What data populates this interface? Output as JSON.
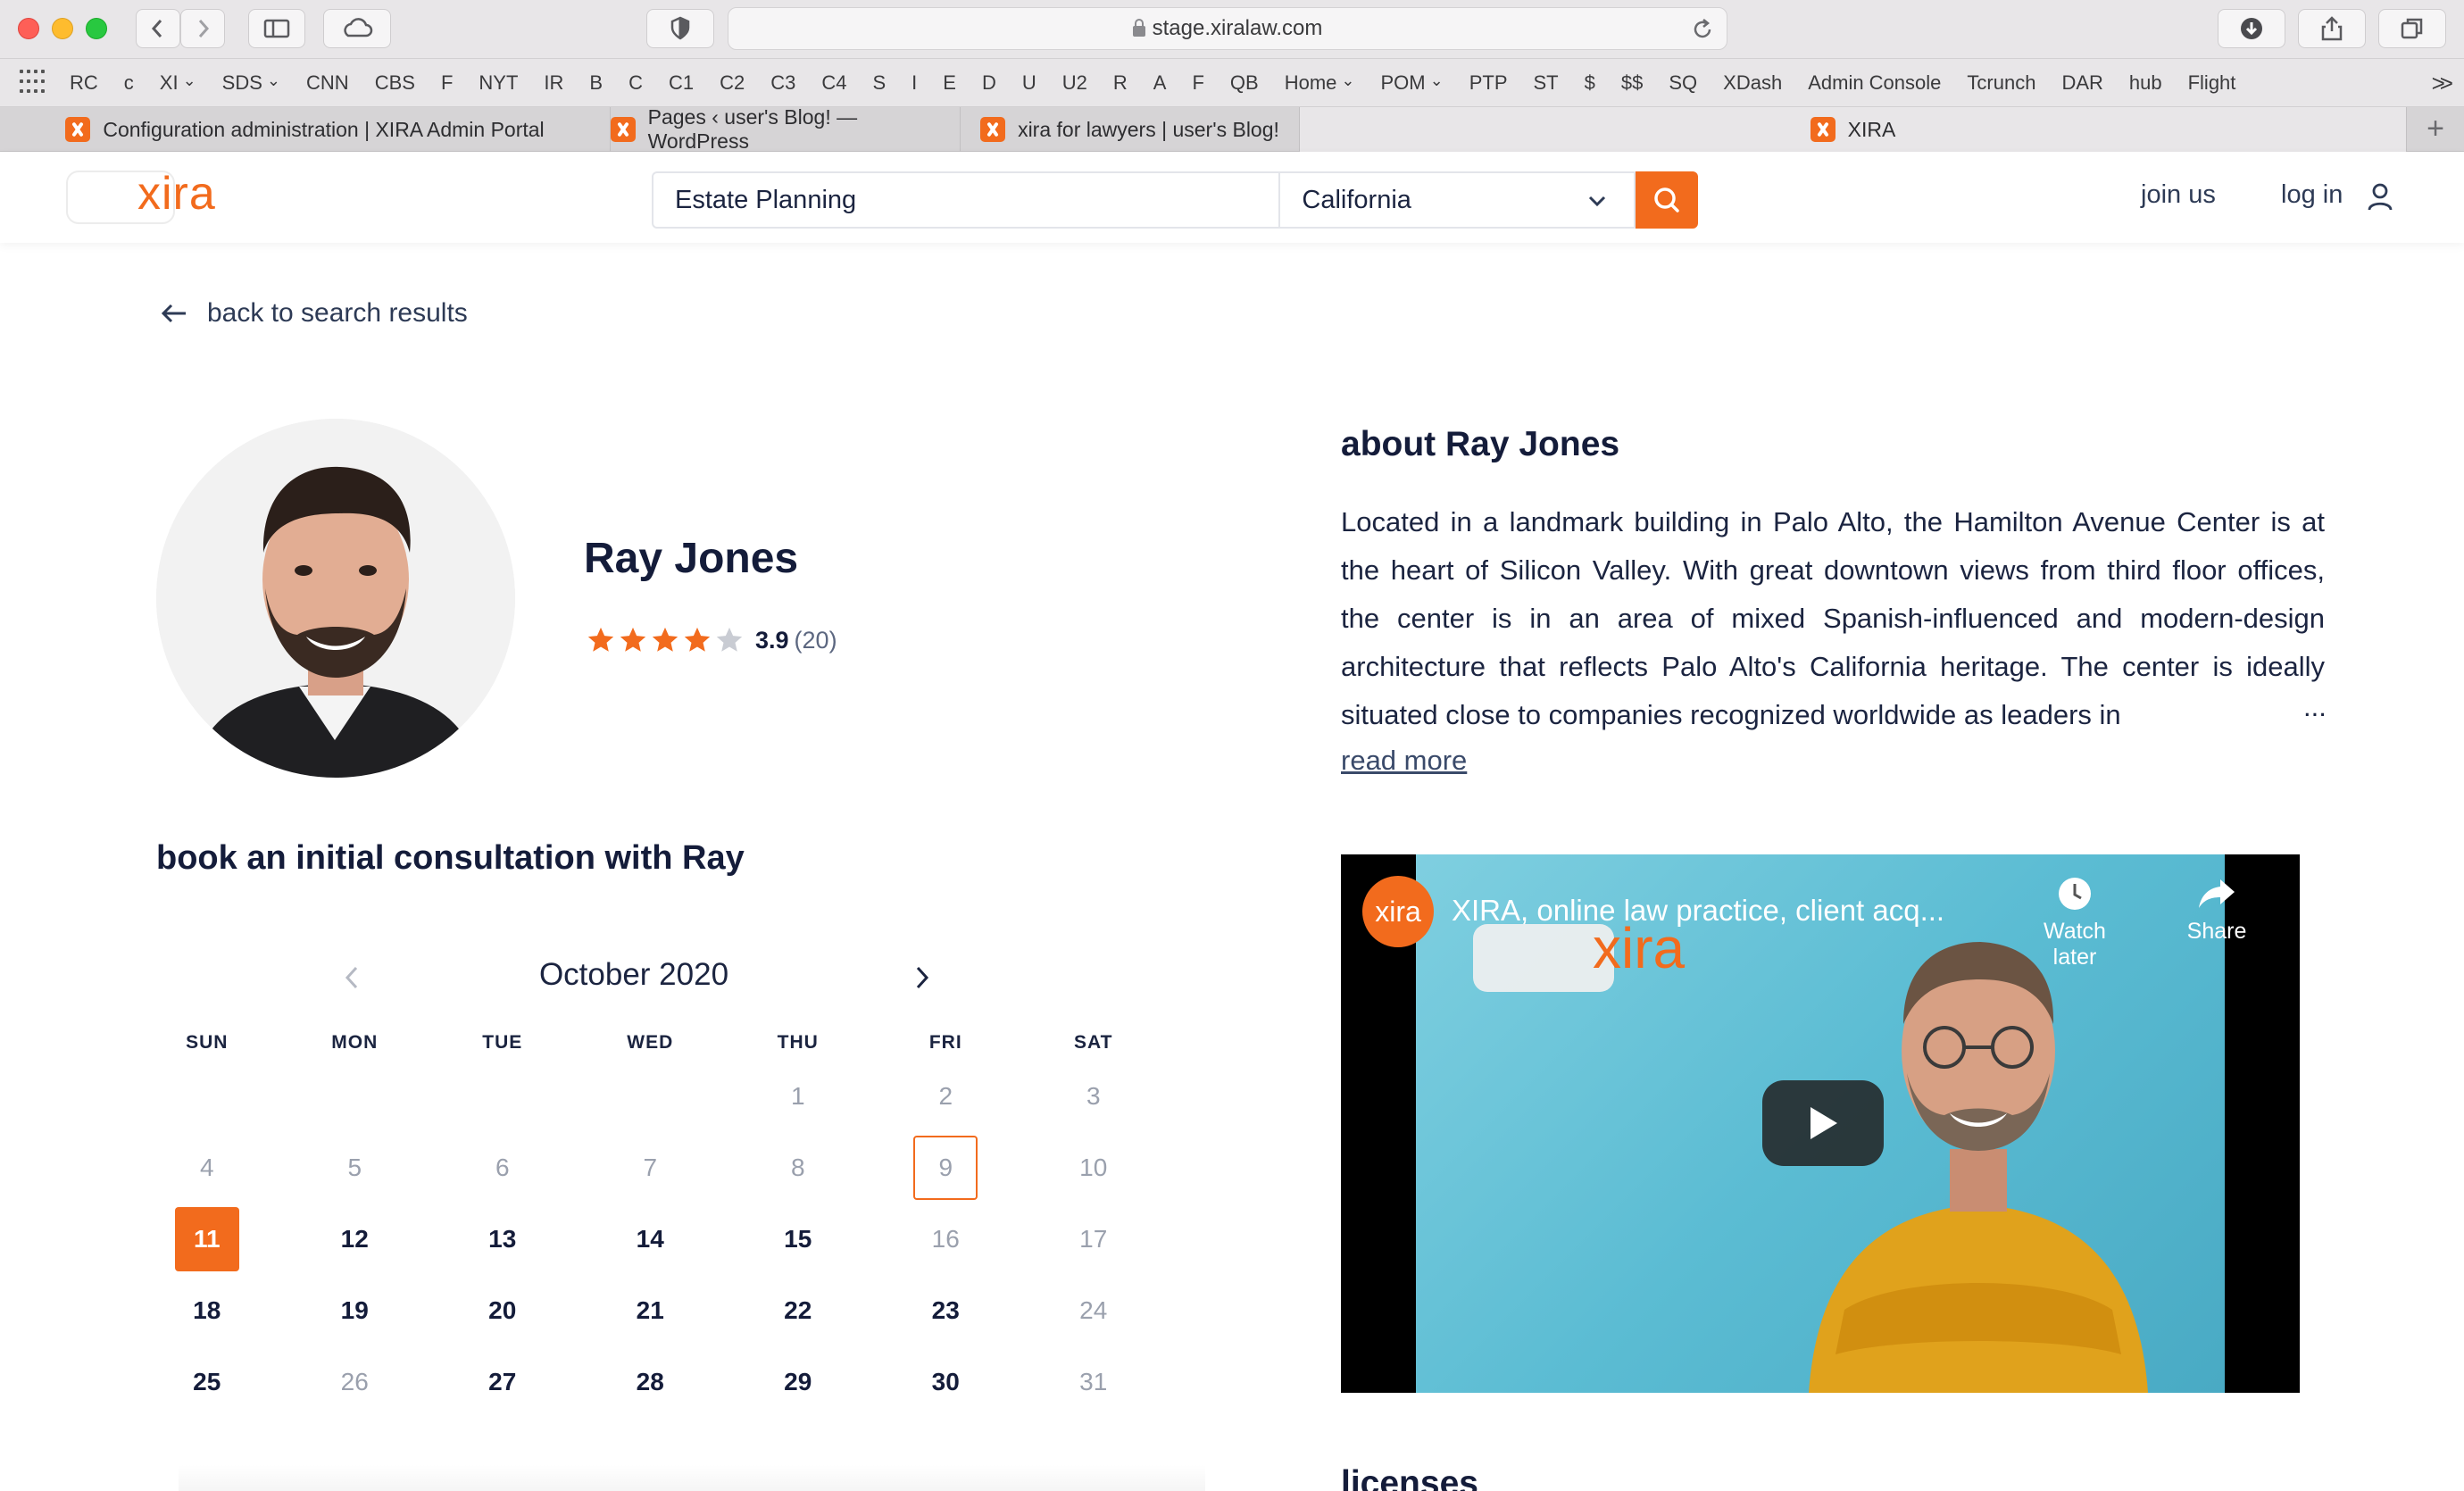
{
  "browser": {
    "url": "stage.xiralaw.com",
    "bookmarks": [
      {
        "label": "RC",
        "dropdown": false
      },
      {
        "label": "c",
        "dropdown": false
      },
      {
        "label": "XI",
        "dropdown": true
      },
      {
        "label": "SDS",
        "dropdown": true
      },
      {
        "label": "CNN",
        "dropdown": false
      },
      {
        "label": "CBS",
        "dropdown": false
      },
      {
        "label": "F",
        "dropdown": false
      },
      {
        "label": "NYT",
        "dropdown": false
      },
      {
        "label": "IR",
        "dropdown": false
      },
      {
        "label": "B",
        "dropdown": false
      },
      {
        "label": "C",
        "dropdown": false
      },
      {
        "label": "C1",
        "dropdown": false
      },
      {
        "label": "C2",
        "dropdown": false
      },
      {
        "label": "C3",
        "dropdown": false
      },
      {
        "label": "C4",
        "dropdown": false
      },
      {
        "label": "S",
        "dropdown": false
      },
      {
        "label": "I",
        "dropdown": false
      },
      {
        "label": "E",
        "dropdown": false
      },
      {
        "label": "D",
        "dropdown": false
      },
      {
        "label": "U",
        "dropdown": false
      },
      {
        "label": "U2",
        "dropdown": false
      },
      {
        "label": "R",
        "dropdown": false
      },
      {
        "label": "A",
        "dropdown": false
      },
      {
        "label": "F",
        "dropdown": false
      },
      {
        "label": "QB",
        "dropdown": false
      },
      {
        "label": "Home",
        "dropdown": true
      },
      {
        "label": "POM",
        "dropdown": true
      },
      {
        "label": "PTP",
        "dropdown": false
      },
      {
        "label": "ST",
        "dropdown": false
      },
      {
        "label": "$",
        "dropdown": false
      },
      {
        "label": "$$",
        "dropdown": false
      },
      {
        "label": "SQ",
        "dropdown": false
      },
      {
        "label": "XDash",
        "dropdown": false
      },
      {
        "label": "Admin Console",
        "dropdown": false
      },
      {
        "label": "Tcrunch",
        "dropdown": false
      },
      {
        "label": "DAR",
        "dropdown": false
      },
      {
        "label": "hub",
        "dropdown": false
      },
      {
        "label": "Flight",
        "dropdown": false
      }
    ],
    "bookmarks_more": ">>",
    "tabs": [
      {
        "label": "Configuration administration | XIRA Admin Portal",
        "active": false
      },
      {
        "label": "Pages ‹ user's Blog! — WordPress",
        "active": false
      },
      {
        "label": "xira for lawyers | user's Blog!",
        "active": false
      },
      {
        "label": "XIRA",
        "active": true
      }
    ],
    "new_tab": "+"
  },
  "header": {
    "logo": "xira",
    "search_value": "Estate Planning",
    "location": "California",
    "join_label": "join us",
    "login_label": "log in"
  },
  "back_label": "back to search results",
  "lawyer": {
    "name": "Ray Jones",
    "rating_value": "3.9",
    "rating_count": "(20)",
    "rating_stars": 3.9,
    "rating_max": 5
  },
  "booking": {
    "title": "book an initial consultation with Ray",
    "month": "October 2020",
    "weekdays": [
      "SUN",
      "MON",
      "TUE",
      "WED",
      "THU",
      "FRI",
      "SAT"
    ],
    "days": [
      {
        "d": "",
        "s": "empty"
      },
      {
        "d": "",
        "s": "empty"
      },
      {
        "d": "",
        "s": "empty"
      },
      {
        "d": "",
        "s": "empty"
      },
      {
        "d": "1",
        "s": "dis"
      },
      {
        "d": "2",
        "s": "dis"
      },
      {
        "d": "3",
        "s": "dis"
      },
      {
        "d": "4",
        "s": "dis"
      },
      {
        "d": "5",
        "s": "dis"
      },
      {
        "d": "6",
        "s": "dis"
      },
      {
        "d": "7",
        "s": "dis"
      },
      {
        "d": "8",
        "s": "dis"
      },
      {
        "d": "9",
        "s": "today"
      },
      {
        "d": "10",
        "s": "dis"
      },
      {
        "d": "11",
        "s": "selected"
      },
      {
        "d": "12",
        "s": "avail"
      },
      {
        "d": "13",
        "s": "avail"
      },
      {
        "d": "14",
        "s": "avail"
      },
      {
        "d": "15",
        "s": "avail"
      },
      {
        "d": "16",
        "s": "dis"
      },
      {
        "d": "17",
        "s": "dis"
      },
      {
        "d": "18",
        "s": "avail"
      },
      {
        "d": "19",
        "s": "avail"
      },
      {
        "d": "20",
        "s": "avail"
      },
      {
        "d": "21",
        "s": "avail"
      },
      {
        "d": "22",
        "s": "avail"
      },
      {
        "d": "23",
        "s": "avail"
      },
      {
        "d": "24",
        "s": "dis"
      },
      {
        "d": "25",
        "s": "avail"
      },
      {
        "d": "26",
        "s": "dis"
      },
      {
        "d": "27",
        "s": "avail"
      },
      {
        "d": "28",
        "s": "avail"
      },
      {
        "d": "29",
        "s": "avail"
      },
      {
        "d": "30",
        "s": "avail"
      },
      {
        "d": "31",
        "s": "dis"
      }
    ]
  },
  "about": {
    "title": "about Ray Jones",
    "text": "Located in a landmark building in Palo Alto, the Hamilton Avenue Center is at the heart of Silicon Valley. With great downtown views from third floor offices, the center is in an area of mixed Spanish-influenced and modern-design architecture that reflects Palo Alto's California heritage. The center is ideally situated close to companies recognized worldwide as leaders in",
    "ellipsis": "...",
    "read_more": "read more"
  },
  "video": {
    "channel_logo": "xira",
    "title": "XIRA, online law practice, client acq...",
    "watch_later": "Watch later",
    "share": "Share",
    "logo": "xira"
  },
  "licenses_title": "licenses",
  "colors": {
    "accent": "#f26b1d",
    "navy": "#141c3a",
    "star_empty": "#c9ccd3"
  }
}
